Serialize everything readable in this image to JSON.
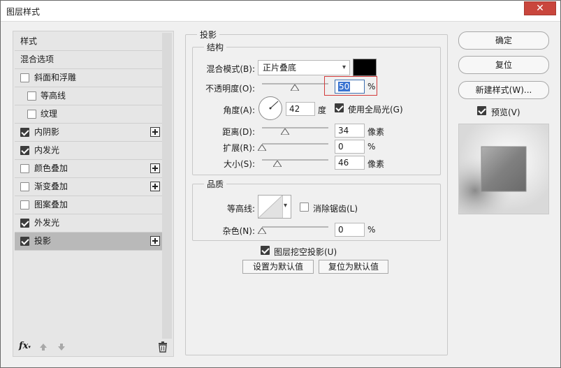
{
  "window": {
    "title": "图层样式",
    "close_glyph": "✕"
  },
  "styles_panel": {
    "header": "样式",
    "blend_options": "混合选项",
    "items": [
      {
        "label": "斜面和浮雕",
        "checked": false,
        "has_plus": false,
        "indent": false
      },
      {
        "label": "等高线",
        "checked": false,
        "has_plus": false,
        "indent": true
      },
      {
        "label": "纹理",
        "checked": false,
        "has_plus": false,
        "indent": true
      },
      {
        "label": "内阴影",
        "checked": true,
        "has_plus": true,
        "indent": false
      },
      {
        "label": "内发光",
        "checked": true,
        "has_plus": false,
        "indent": false
      },
      {
        "label": "颜色叠加",
        "checked": false,
        "has_plus": true,
        "indent": false
      },
      {
        "label": "渐变叠加",
        "checked": false,
        "has_plus": true,
        "indent": false
      },
      {
        "label": "图案叠加",
        "checked": false,
        "has_plus": false,
        "indent": false
      },
      {
        "label": "外发光",
        "checked": true,
        "has_plus": false,
        "indent": false
      },
      {
        "label": "投影",
        "checked": true,
        "has_plus": true,
        "indent": false,
        "selected": true
      }
    ],
    "toolbar": {
      "fx_label": "fx",
      "fx_caret": "▾"
    }
  },
  "drop_shadow": {
    "section_title": "投影",
    "structure": {
      "title": "结构",
      "blend_mode_label": "混合模式(B):",
      "blend_mode_value": "正片叠底",
      "blend_color": "#000000",
      "opacity_label": "不透明度(O):",
      "opacity_value": "50",
      "opacity_unit": "%",
      "angle_label": "角度(A):",
      "angle_value": "42",
      "angle_unit": "度",
      "global_light_label": "使用全局光(G)",
      "global_light_checked": true,
      "distance_label": "距离(D):",
      "distance_value": "34",
      "distance_unit": "像素",
      "spread_label": "扩展(R):",
      "spread_value": "0",
      "spread_unit": "%",
      "size_label": "大小(S):",
      "size_value": "46",
      "size_unit": "像素"
    },
    "quality": {
      "title": "品质",
      "contour_label": "等高线:",
      "anti_alias_label": "消除锯齿(L)",
      "anti_alias_checked": false,
      "noise_label": "杂色(N):",
      "noise_value": "0",
      "noise_unit": "%"
    },
    "knockout_label": "图层挖空投影(U)",
    "knockout_checked": true,
    "set_default_label": "设置为默认值",
    "reset_default_label": "复位为默认值"
  },
  "right_panel": {
    "ok_label": "确定",
    "reset_label": "复位",
    "new_style_label": "新建样式(W)...",
    "preview_label": "预览(V)",
    "preview_checked": true
  }
}
